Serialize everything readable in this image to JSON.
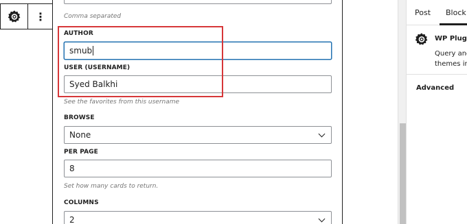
{
  "toolbar": {
    "block_icon": "gear-icon",
    "more_icon": "more-vertical-icon",
    "more_label": "⋮"
  },
  "form": {
    "top_help": "Comma separated",
    "author": {
      "label": "AUTHOR",
      "value": "smub"
    },
    "user": {
      "label": "USER (USERNAME)",
      "value": "Syed Balkhi",
      "help": "See the favorites from this username"
    },
    "browse": {
      "label": "BROWSE",
      "value": "None"
    },
    "per_page": {
      "label": "PER PAGE",
      "value": "8",
      "help": "Set how many cards to return."
    },
    "columns": {
      "label": "COLUMNS",
      "value": "2"
    }
  },
  "sidebar": {
    "tabs": [
      {
        "label": "Post",
        "active": false
      },
      {
        "label": "Block",
        "active": true
      }
    ],
    "block_card": {
      "icon": "gear-icon",
      "title": "WP Plugin",
      "description": "Query and themes in"
    },
    "advanced_label": "Advanced"
  },
  "colors": {
    "highlight": "#d63638",
    "focus": "#2271b1",
    "help_text": "#757575"
  }
}
